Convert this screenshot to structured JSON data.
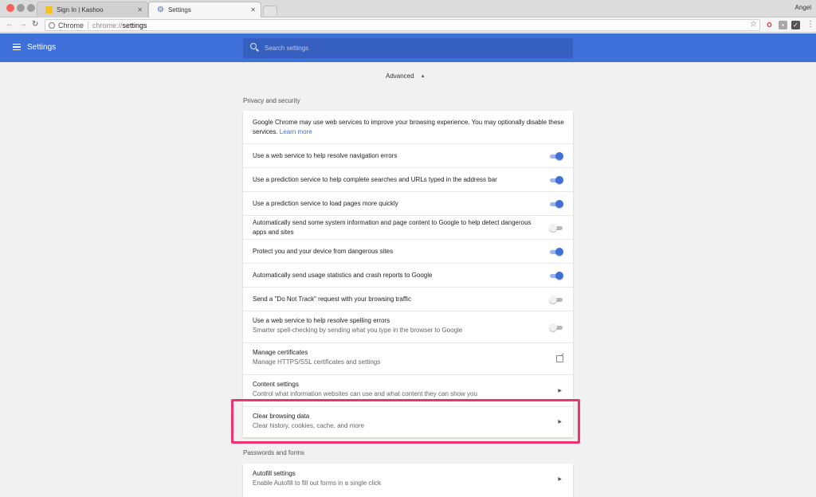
{
  "browser": {
    "tabs": [
      {
        "title": "Sign In | Kashoo"
      },
      {
        "title": "Settings"
      }
    ],
    "user_name": "Angel",
    "omnibox": {
      "chip_label": "Chrome",
      "url_scheme": "chrome://",
      "url_host": "settings"
    }
  },
  "header": {
    "title": "Settings",
    "search_placeholder": "Search settings"
  },
  "advanced_label": "Advanced",
  "privacy": {
    "heading": "Privacy and security",
    "intro_text": "Google Chrome may use web services to improve your browsing experience. You may optionally disable these services. ",
    "learn_more": "Learn more",
    "items": [
      {
        "label": "Use a web service to help resolve navigation errors",
        "enabled": true
      },
      {
        "label": "Use a prediction service to help complete searches and URLs typed in the address bar",
        "enabled": true
      },
      {
        "label": "Use a prediction service to load pages more quickly",
        "enabled": true
      },
      {
        "label": "Automatically send some system information and page content to Google to help detect dangerous apps and sites",
        "enabled": false
      },
      {
        "label": "Protect you and your device from dangerous sites",
        "enabled": true
      },
      {
        "label": "Automatically send usage statistics and crash reports to Google",
        "enabled": true
      },
      {
        "label": "Send a \"Do Not Track\" request with your browsing traffic",
        "enabled": false
      },
      {
        "label": "Use a web service to help resolve spelling errors",
        "sublabel": "Smarter spell-checking by sending what you type in the browser to Google",
        "enabled": false
      }
    ],
    "manage_certificates": {
      "label": "Manage certificates",
      "sublabel": "Manage HTTPS/SSL certificates and settings"
    },
    "content_settings": {
      "label": "Content settings",
      "sublabel": "Control what information websites can use and what content they can show you"
    },
    "clear_browsing_data": {
      "label": "Clear browsing data",
      "sublabel": "Clear history, cookies, cache, and more"
    }
  },
  "passwords": {
    "heading": "Passwords and forms",
    "autofill": {
      "label": "Autofill settings",
      "sublabel": "Enable Autofill to fill out forms in a single click"
    }
  },
  "colors": {
    "brand_blue": "#3f6fd8",
    "highlight_pink": "#f0326e"
  },
  "icons": [
    "hamburger-icon",
    "search-icon",
    "toggle-switch",
    "chevron-right-icon",
    "external-link-icon",
    "star-icon",
    "reload-icon"
  ]
}
